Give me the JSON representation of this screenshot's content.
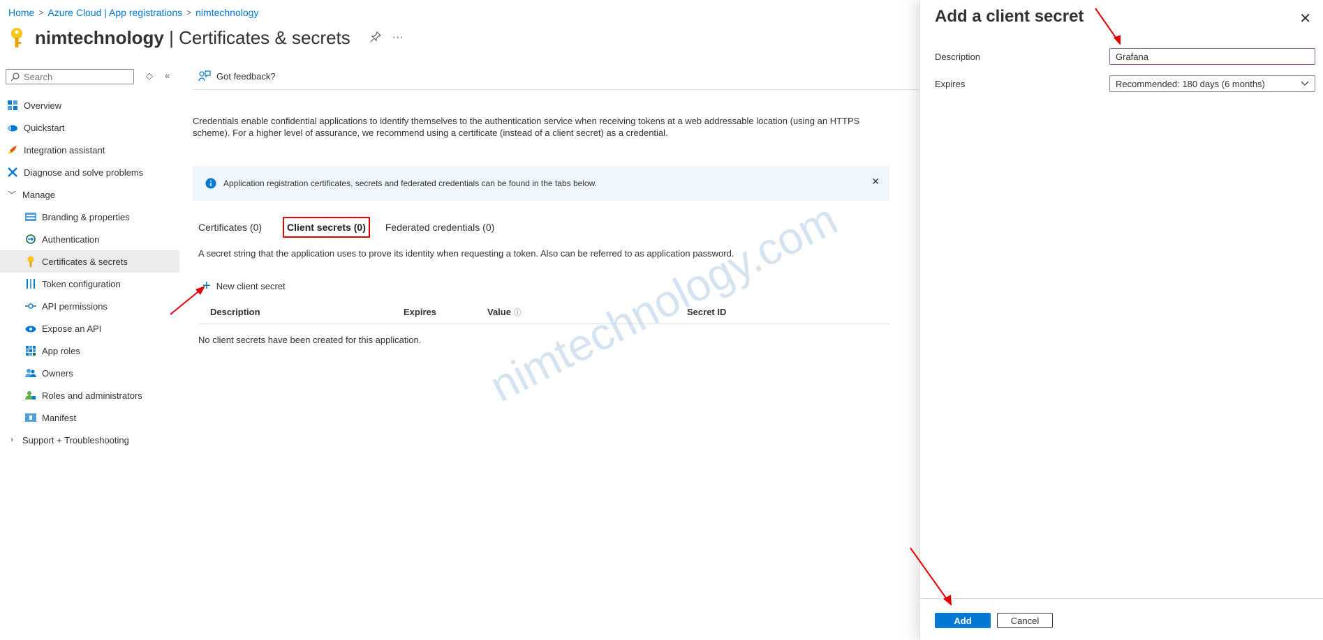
{
  "breadcrumb": {
    "home": "Home",
    "registrations": "Azure Cloud | App registrations",
    "app": "nimtechnology",
    "sep": ">"
  },
  "header": {
    "app_name": "nimtechnology",
    "separator": "|",
    "page_title": "Certificates & secrets",
    "more": "···"
  },
  "sidebar": {
    "search_placeholder": "Search",
    "items": [
      {
        "label": "Overview"
      },
      {
        "label": "Quickstart"
      },
      {
        "label": "Integration assistant"
      },
      {
        "label": "Diagnose and solve problems"
      },
      {
        "label": "Manage"
      },
      {
        "label": "Branding & properties"
      },
      {
        "label": "Authentication"
      },
      {
        "label": "Certificates & secrets"
      },
      {
        "label": "Token configuration"
      },
      {
        "label": "API permissions"
      },
      {
        "label": "Expose an API"
      },
      {
        "label": "App roles"
      },
      {
        "label": "Owners"
      },
      {
        "label": "Roles and administrators"
      },
      {
        "label": "Manifest"
      },
      {
        "label": "Support + Troubleshooting"
      }
    ]
  },
  "main": {
    "feedback": "Got feedback?",
    "intro": "Credentials enable confidential applications to identify themselves to the authentication service when receiving tokens at a web addressable location (using an HTTPS scheme). For a higher level of assurance, we recommend using a certificate (instead of a client secret) as a credential.",
    "info_message": "Application registration certificates, secrets and federated credentials can be found in the tabs below.",
    "tabs": [
      {
        "label": "Certificates (0)"
      },
      {
        "label": "Client secrets (0)"
      },
      {
        "label": "Federated credentials (0)"
      }
    ],
    "secret_description": "A secret string that the application uses to prove its identity when requesting a token. Also can be referred to as application password.",
    "new_secret_label": "New client secret",
    "columns": [
      "Description",
      "Expires",
      "Value",
      "Secret ID"
    ],
    "empty_message": "No client secrets have been created for this application.",
    "watermark": "nimtechnology.com"
  },
  "panel": {
    "title": "Add a client secret",
    "description_label": "Description",
    "description_value": "Grafana",
    "expires_label": "Expires",
    "expires_value": "Recommended: 180 days (6 months)",
    "add_label": "Add",
    "cancel_label": "Cancel"
  },
  "colors": {
    "accent": "#0078d4",
    "highlight": "#e00000",
    "info_bg": "#eff6fc"
  }
}
